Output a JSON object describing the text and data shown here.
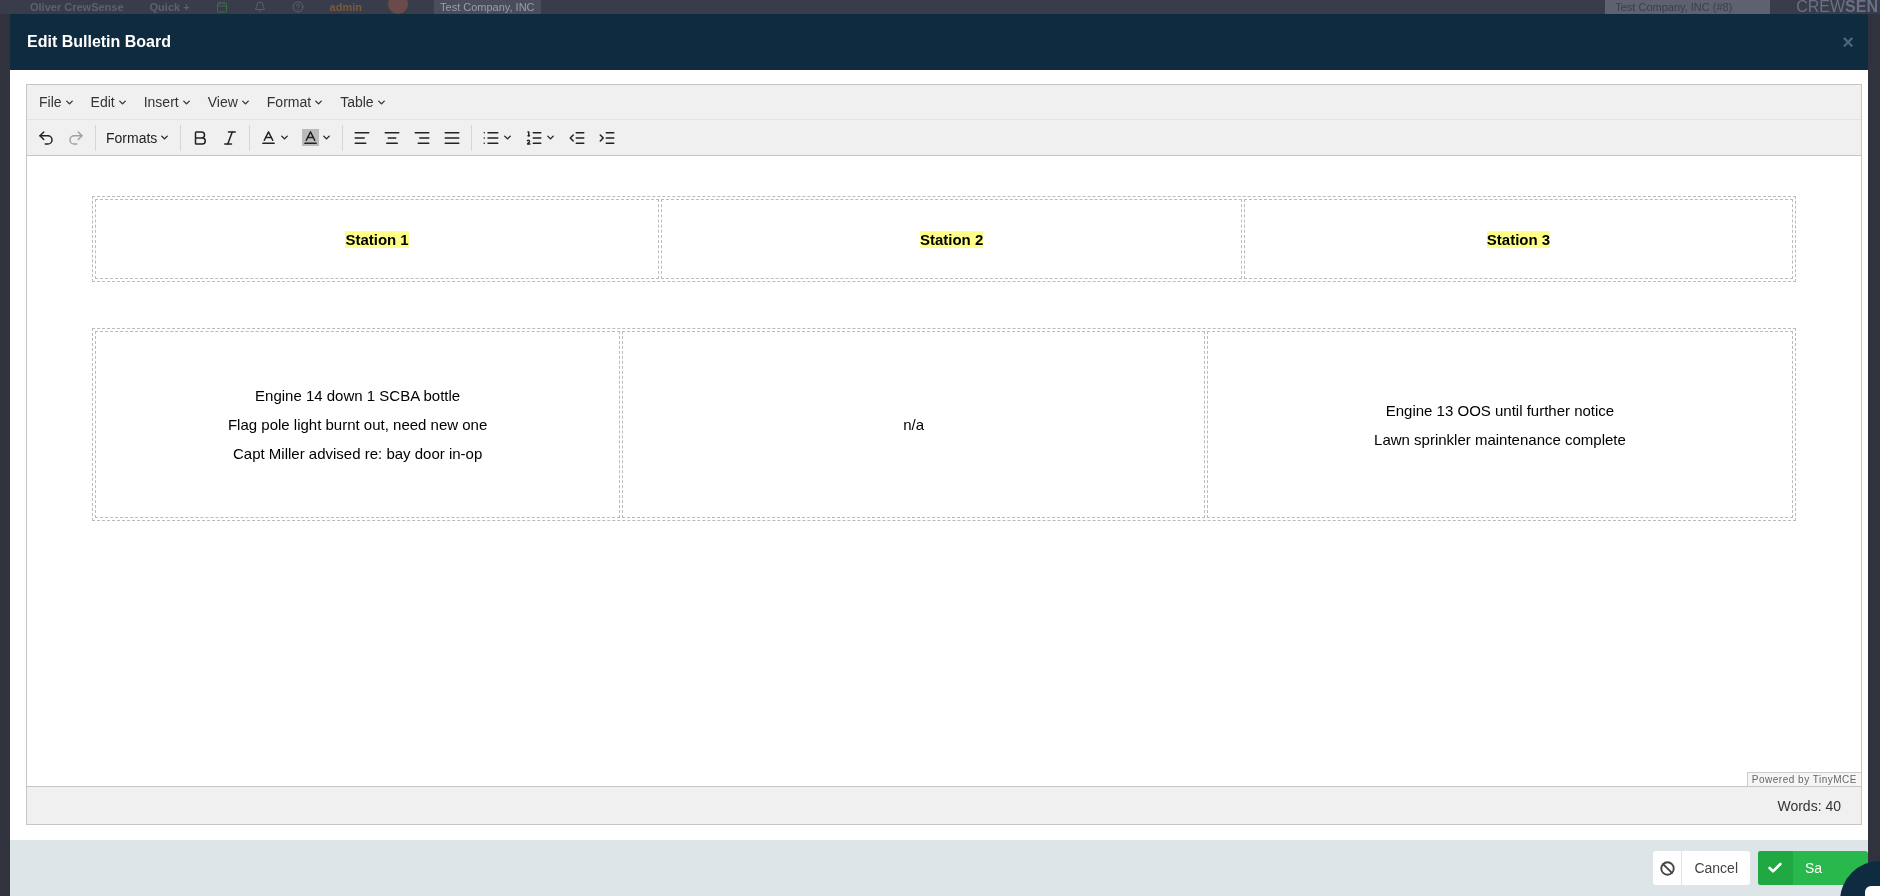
{
  "app_bar": {
    "user": "Oliver CrewSense",
    "quick": "Quick +",
    "role": "admin",
    "company": "Test Company, INC",
    "company_select": "Test Company, INC (#8)",
    "logo_light": "CREW",
    "logo_bold": "SEN"
  },
  "dialog": {
    "title": "Edit Bulletin Board",
    "close": "×"
  },
  "editor": {
    "menus": [
      "File",
      "Edit",
      "Insert",
      "View",
      "Format",
      "Table"
    ],
    "toolbar": [
      {
        "kind": "undo",
        "disabled": false
      },
      {
        "kind": "redo",
        "disabled": true
      },
      {
        "kind": "separator"
      },
      {
        "kind": "dropdown",
        "label": "Formats"
      },
      {
        "kind": "separator"
      },
      {
        "kind": "bold",
        "disabled": false
      },
      {
        "kind": "italic",
        "disabled": false
      },
      {
        "kind": "separator"
      },
      {
        "kind": "text-color",
        "disabled": false
      },
      {
        "kind": "background-color",
        "disabled": false
      },
      {
        "kind": "separator"
      },
      {
        "kind": "align-left",
        "disabled": false
      },
      {
        "kind": "align-center",
        "disabled": false
      },
      {
        "kind": "align-right",
        "disabled": false
      },
      {
        "kind": "align-justify",
        "disabled": false
      },
      {
        "kind": "separator"
      },
      {
        "kind": "bullet-list",
        "disabled": false
      },
      {
        "kind": "numbered-list",
        "disabled": false
      },
      {
        "kind": "outdent",
        "disabled": false
      },
      {
        "kind": "indent",
        "disabled": false
      }
    ],
    "tables": [
      {
        "cells": [
          {
            "kind": "heading",
            "lines": [
              "Station 1"
            ]
          },
          {
            "kind": "heading",
            "lines": [
              "Station 2"
            ]
          },
          {
            "kind": "heading",
            "lines": [
              "Station 3"
            ]
          }
        ]
      },
      {
        "cells": [
          {
            "kind": "body",
            "lines": [
              "Engine 14 down 1 SCBA bottle",
              "Flag pole light burnt out, need new one",
              "Capt Miller advised re: bay door in-op"
            ]
          },
          {
            "kind": "body",
            "lines": [
              "n/a"
            ]
          },
          {
            "kind": "body",
            "lines": [
              "Engine 13 OOS until further notice",
              "Lawn sprinkler maintenance complete"
            ]
          }
        ]
      }
    ],
    "branding": "Powered by TinyMCE",
    "word_count": "Words: 40"
  },
  "footer": {
    "buttons": [
      {
        "kind": "cancel",
        "label": "Cancel"
      },
      {
        "kind": "save",
        "label": "Sa"
      }
    ]
  }
}
